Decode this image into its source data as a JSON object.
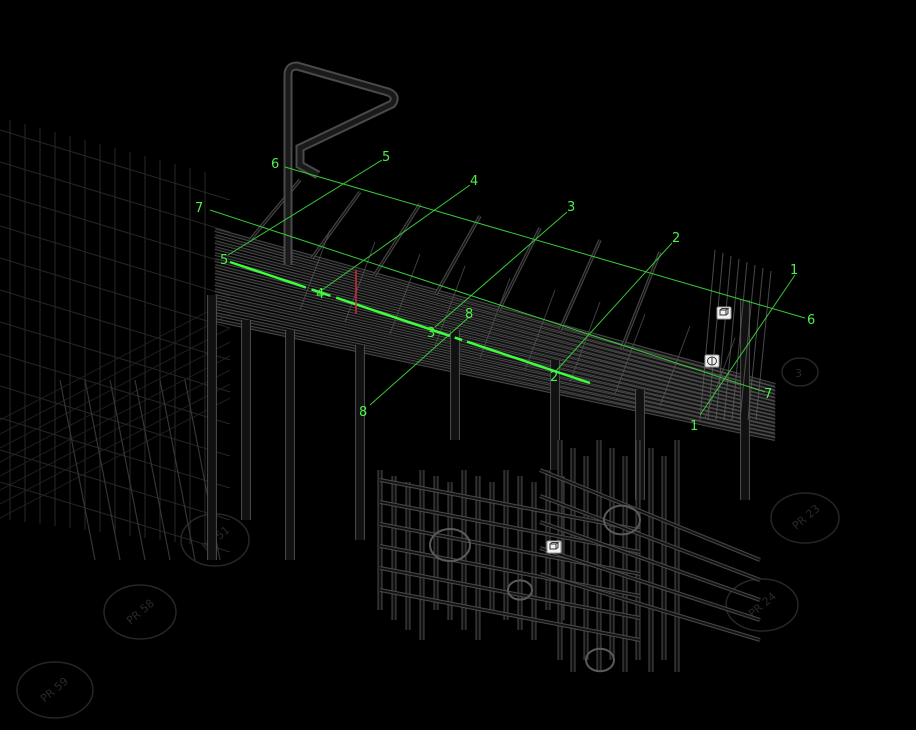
{
  "colors": {
    "background": "#000000",
    "grid_line": "#38c838",
    "grid_label": "#4cf04c",
    "section_line": "#3cff3c",
    "wireframe": "#5a5a5a",
    "wireframe_dim": "#2e2e2e",
    "marker_red": "#d9263a",
    "pad_ring": "#262626"
  },
  "grid_labels": {
    "a1_top": "1",
    "a1_bottom": "1",
    "a2_top": "2",
    "a2_bottom": "2",
    "a3_top": "3",
    "a3_bottom": "3",
    "a4_top": "4",
    "a4_bottom": "4",
    "a5_top": "5",
    "a5_bottom": "5",
    "b6_left": "6",
    "b6_right": "6",
    "b7_left": "7",
    "b7_right": "7",
    "b8_top": "8",
    "b8_bottom": "8"
  },
  "pads": {
    "p51": "PR 51",
    "p58": "PR 58",
    "p59": "PR 59",
    "p23": "PR 23",
    "p24": "PR 24",
    "p3": "3"
  },
  "markers": {
    "view_cube_icon": "cube-icon",
    "section_icon": "section-icon"
  }
}
